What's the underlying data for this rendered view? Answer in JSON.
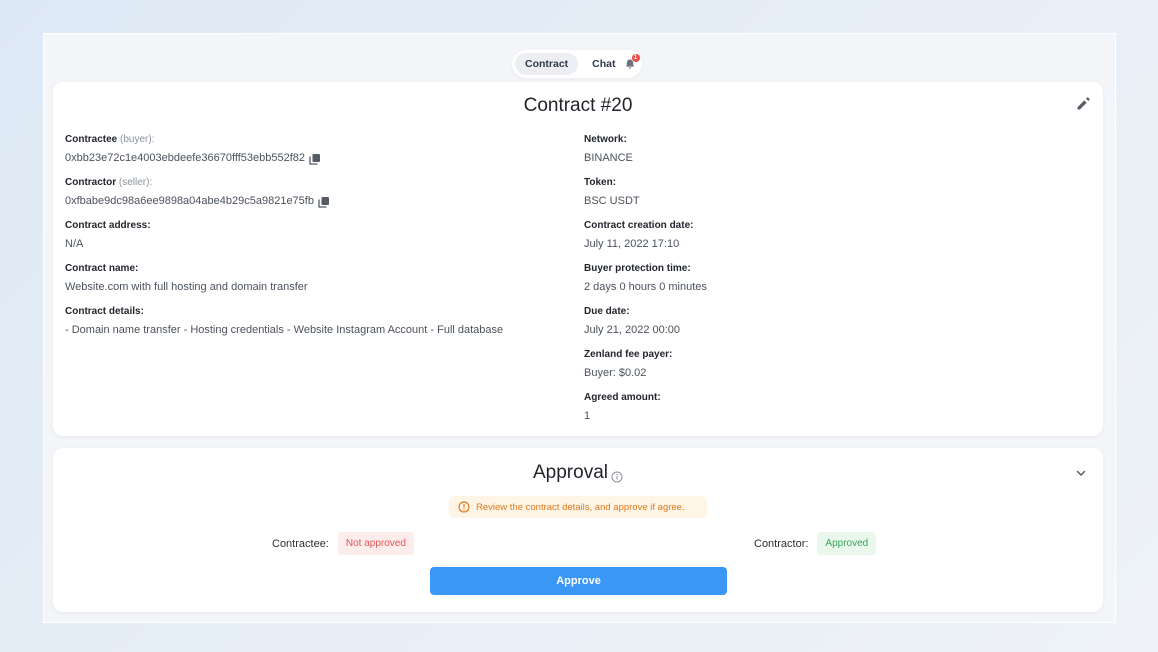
{
  "tabs": {
    "contract": "Contract",
    "chat": "Chat",
    "chat_badge": "1"
  },
  "contract": {
    "title": "Contract #20",
    "left": [
      {
        "label": "Contractee",
        "hint": "(buyer):",
        "value": "0xbb23e72c1e4003ebdeefe36670fff53ebb552f82",
        "copyable": true
      },
      {
        "label": "Contractor",
        "hint": "(seller):",
        "value": "0xfbabe9dc98a6ee9898a04abe4b29c5a9821e75fb",
        "copyable": true
      },
      {
        "label": "Contract address:",
        "hint": "",
        "value": "N/A"
      },
      {
        "label": "Contract name:",
        "hint": "",
        "value": "Website.com with full hosting and domain transfer"
      },
      {
        "label": "Contract details:",
        "hint": "",
        "value": "- Domain name transfer - Hosting credentials - Website Instagram Account - Full database"
      }
    ],
    "right": [
      {
        "label": "Network:",
        "value": "BINANCE"
      },
      {
        "label": "Token:",
        "value": "BSC USDT"
      },
      {
        "label": "Contract creation date:",
        "value": "July 11, 2022 17:10"
      },
      {
        "label": "Buyer protection time:",
        "value": "2 days 0 hours 0 minutes"
      },
      {
        "label": "Due date:",
        "value": "July 21, 2022 00:00"
      },
      {
        "label": "Zenland fee payer:",
        "value": "Buyer: $0.02"
      },
      {
        "label": "Agreed amount:",
        "value": "1"
      }
    ]
  },
  "approval": {
    "title": "Approval",
    "notice": "Review the contract details, and approve if agree.",
    "contractee_label": "Contractee:",
    "contractee_status": "Not approved",
    "contractor_label": "Contractor:",
    "contractor_status": "Approved",
    "approve_button": "Approve"
  },
  "colors": {
    "accent": "#3b97f6",
    "not_approved": "#e35757",
    "approved": "#3aa45a",
    "warning": "#e07a1a"
  }
}
